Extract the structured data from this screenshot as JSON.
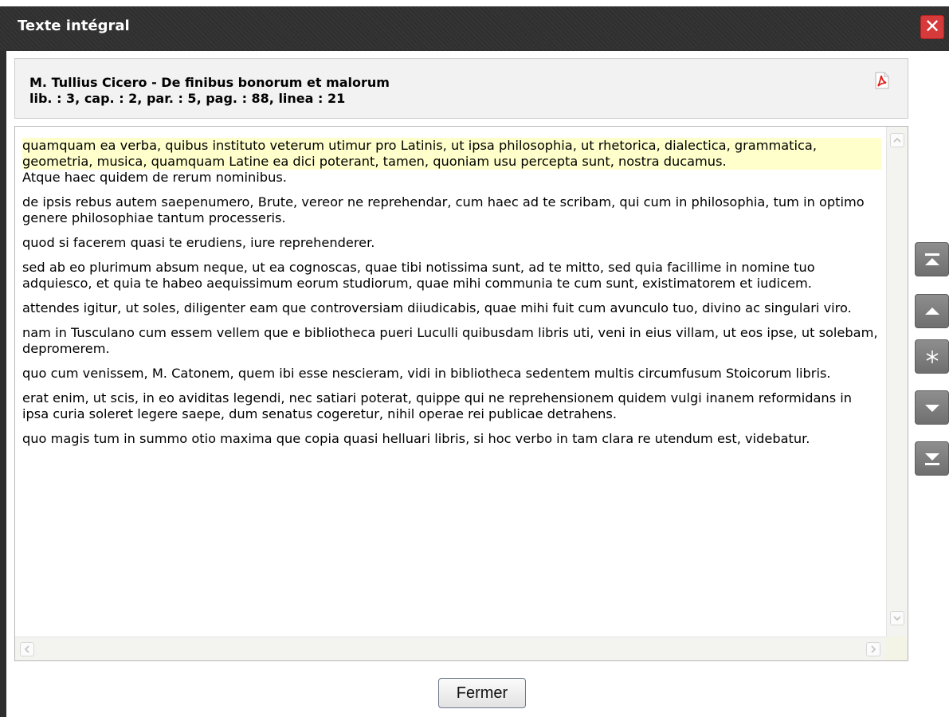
{
  "dialog": {
    "title": "Texte intégral",
    "close_icon": "close-x-icon"
  },
  "header": {
    "title": "M. Tullius Cicero - De finibus bonorum et malorum",
    "reference": "lib. : 3, cap. : 2, par. : 5, pag. : 88, linea : 21",
    "pdf_icon": "pdf-icon"
  },
  "text": {
    "highlighted_paragraph": "quamquam ea verba, quibus instituto veterum utimur pro Latinis, ut ipsa philosophia, ut rhetorica, dialectica, grammatica, geometria, musica, quamquam Latine ea dici poterant, tamen, quoniam usu percepta sunt, nostra ducamus.",
    "paragraphs": [
      "Atque haec quidem de rerum nominibus.",
      "de ipsis rebus autem saepenumero, Brute, vereor ne reprehendar, cum haec ad te scribam, qui cum in philosophia, tum in optimo genere philosophiae tantum processeris.",
      "quod si facerem quasi te erudiens, iure reprehenderer.",
      "sed ab eo plurimum absum neque, ut ea cognoscas, quae tibi notissima sunt, ad te mitto, sed quia facillime in nomine tuo adquiesco, et quia te habeo aequissimum eorum studiorum, quae mihi communia te cum sunt, existimatorem et iudicem.",
      "attendes igitur, ut soles, diligenter eam que controversiam diiudicabis, quae mihi fuit cum avunculo tuo, divino ac singulari viro.",
      "nam in Tusculano cum essem vellem que e bibliotheca pueri Luculli quibusdam libris uti, veni in eius villam, ut eos ipse, ut solebam, depromerem.",
      "quo cum venissem, M. Catonem, quem ibi esse nescieram, vidi in bibliotheca sedentem multis circumfusum Stoicorum libris.",
      "erat enim, ut scis, in eo aviditas legendi, nec satiari poterat, quippe qui ne reprehensionem quidem vulgi inanem reformidans in ipsa curia soleret legere saepe, dum senatus cogeretur, nihil operae rei publicae detrahens.",
      "quo magis tum in summo otio maxima que copia quasi helluari libris, si hoc verbo in tam clara re utendum est, videbatur."
    ],
    "highlight_color": "#ffffcc"
  },
  "navigation": {
    "buttons": [
      {
        "name": "nav-first-button",
        "icon": "arrow-to-top-icon",
        "label": ""
      },
      {
        "name": "nav-up-button",
        "icon": "arrow-up-icon",
        "label": ""
      },
      {
        "name": "nav-current-button",
        "icon": "asterisk-icon",
        "label": "*"
      },
      {
        "name": "nav-down-button",
        "icon": "arrow-down-icon",
        "label": ""
      },
      {
        "name": "nav-last-button",
        "icon": "arrow-to-bottom-icon",
        "label": ""
      }
    ]
  },
  "footer": {
    "close_label": "Fermer"
  },
  "colors": {
    "titlebar": "#2f2f2f",
    "close_button": "#d63a3a",
    "nav_button": "#7f7f7f"
  }
}
